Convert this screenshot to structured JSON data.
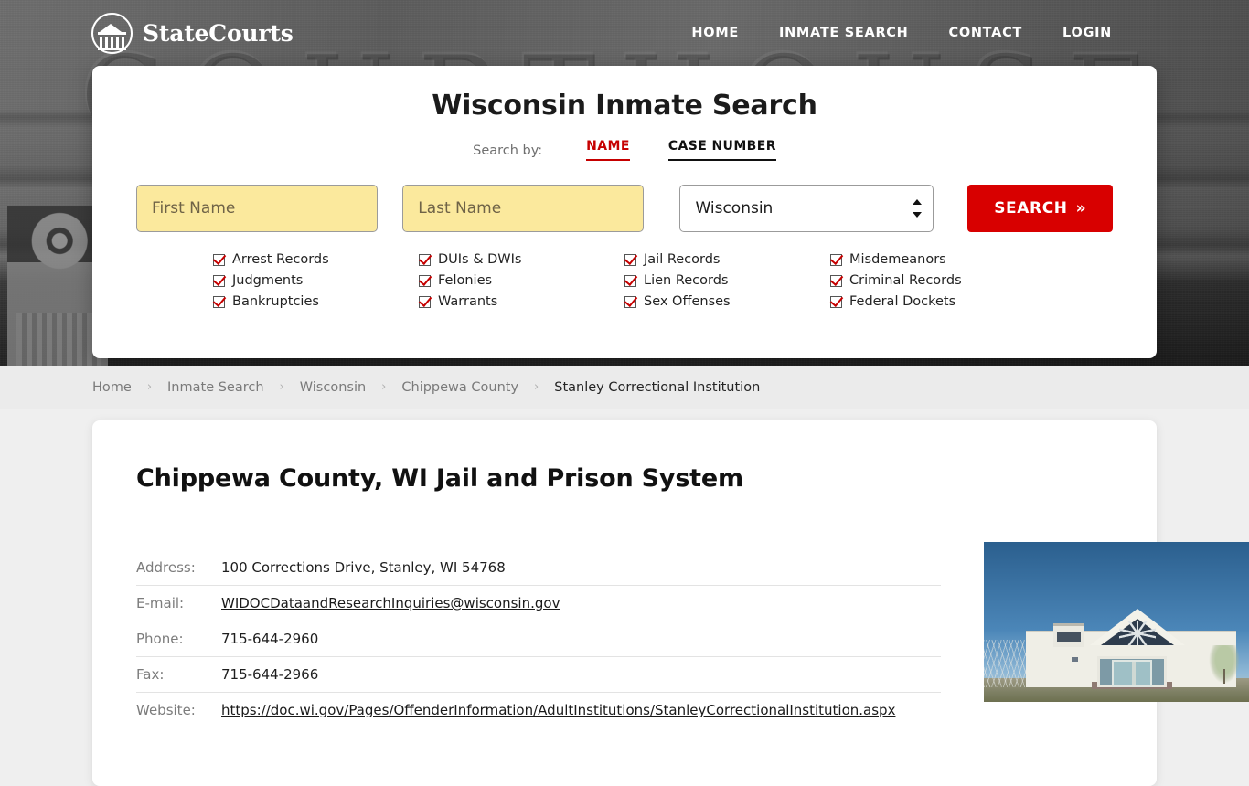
{
  "header": {
    "brand_name": "StateCourts",
    "logo_icon": "courthouse-circle-icon",
    "nav": [
      {
        "label": "HOME",
        "name": "nav-home"
      },
      {
        "label": "INMATE SEARCH",
        "name": "nav-inmate-search"
      },
      {
        "label": "CONTACT",
        "name": "nav-contact"
      },
      {
        "label": "LOGIN",
        "name": "nav-login"
      }
    ],
    "background_word": "COURTHOUSE"
  },
  "search_card": {
    "title": "Wisconsin Inmate Search",
    "search_by_label": "Search by:",
    "tabs": [
      {
        "label": "NAME",
        "active": true
      },
      {
        "label": "CASE NUMBER",
        "active": false
      }
    ],
    "first_name_placeholder": "First Name",
    "first_name_value": "",
    "last_name_placeholder": "Last Name",
    "last_name_value": "",
    "state_selected": "Wisconsin",
    "state_options": [
      "Wisconsin"
    ],
    "search_button_label": "SEARCH",
    "search_button_chevron": "»",
    "checkboxes": [
      "Arrest Records",
      "DUIs & DWIs",
      "Jail Records",
      "Misdemeanors",
      "Judgments",
      "Felonies",
      "Lien Records",
      "Criminal Records",
      "Bankruptcies",
      "Warrants",
      "Sex Offenses",
      "Federal Dockets"
    ],
    "colors": {
      "accent_red": "#c60000",
      "button_red": "#d80000",
      "input_yellow": "#fbe99d"
    }
  },
  "breadcrumb": {
    "separator": "›",
    "items": [
      {
        "label": "Home",
        "current": false
      },
      {
        "label": "Inmate Search",
        "current": false
      },
      {
        "label": "Wisconsin",
        "current": false
      },
      {
        "label": "Chippewa County",
        "current": false
      },
      {
        "label": "Stanley Correctional Institution",
        "current": true
      }
    ]
  },
  "content": {
    "page_title": "Chippewa County, WI Jail and Prison System",
    "info_rows": [
      {
        "key": "Address:",
        "value": "100 Corrections Drive, Stanley, WI 54768",
        "link": false
      },
      {
        "key": "E-mail:",
        "value": "WIDOCDataandResearchInquiries@wisconsin.gov",
        "link": true
      },
      {
        "key": "Phone:",
        "value": "715-644-2960",
        "link": false
      },
      {
        "key": "Fax:",
        "value": "715-644-2966",
        "link": false
      },
      {
        "key": "Website:",
        "value": "https://doc.wi.gov/Pages/OffenderInformation/AdultInstitutions/StanleyCorrectionalInstitution.aspx",
        "link": true
      }
    ],
    "facility_photo_alt": "Stanley Correctional Institution building exterior"
  }
}
